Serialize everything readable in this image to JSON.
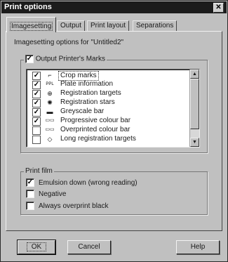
{
  "window": {
    "title": "Print options",
    "close_glyph": "✕"
  },
  "tabs": [
    {
      "label": "Imagesetting",
      "active": true
    },
    {
      "label": "Output",
      "active": false
    },
    {
      "label": "Print layout",
      "active": false
    },
    {
      "label": "Separations",
      "active": false
    }
  ],
  "subtitle": "Imagesetting options for \"Untitled2\"",
  "printer_marks": {
    "legend": "Output Printer's Marks",
    "checked": true,
    "items": [
      {
        "label": "Crop marks",
        "checked": true,
        "icon": "crop-marks-icon",
        "glyph": "⌐",
        "selected": true
      },
      {
        "label": "Plate information",
        "checked": true,
        "icon": "plate-info-icon",
        "glyph": "PPL",
        "selected": false
      },
      {
        "label": "Registration targets",
        "checked": true,
        "icon": "registration-target-icon",
        "glyph": "⊕",
        "selected": false
      },
      {
        "label": "Registration stars",
        "checked": true,
        "icon": "registration-star-icon",
        "glyph": "✺",
        "selected": false
      },
      {
        "label": "Greyscale bar",
        "checked": true,
        "icon": "greyscale-bar-icon",
        "glyph": "▬",
        "selected": false
      },
      {
        "label": "Progressive colour bar",
        "checked": true,
        "icon": "progressive-colour-bar-icon",
        "glyph": "▭▭",
        "selected": false
      },
      {
        "label": "Overprinted colour bar",
        "checked": false,
        "icon": "overprinted-colour-bar-icon",
        "glyph": "▭▭",
        "selected": false
      },
      {
        "label": "Long registration targets",
        "checked": false,
        "icon": "long-registration-icon",
        "glyph": "◇",
        "selected": false
      }
    ]
  },
  "print_film": {
    "legend": "Print film",
    "options": [
      {
        "label": "Emulsion down (wrong reading)",
        "checked": true
      },
      {
        "label": "Negative",
        "checked": false
      },
      {
        "label": "Always overprint black",
        "checked": false
      }
    ]
  },
  "buttons": {
    "ok": "OK",
    "cancel": "Cancel",
    "help": "Help"
  },
  "check_glyph": "✓"
}
